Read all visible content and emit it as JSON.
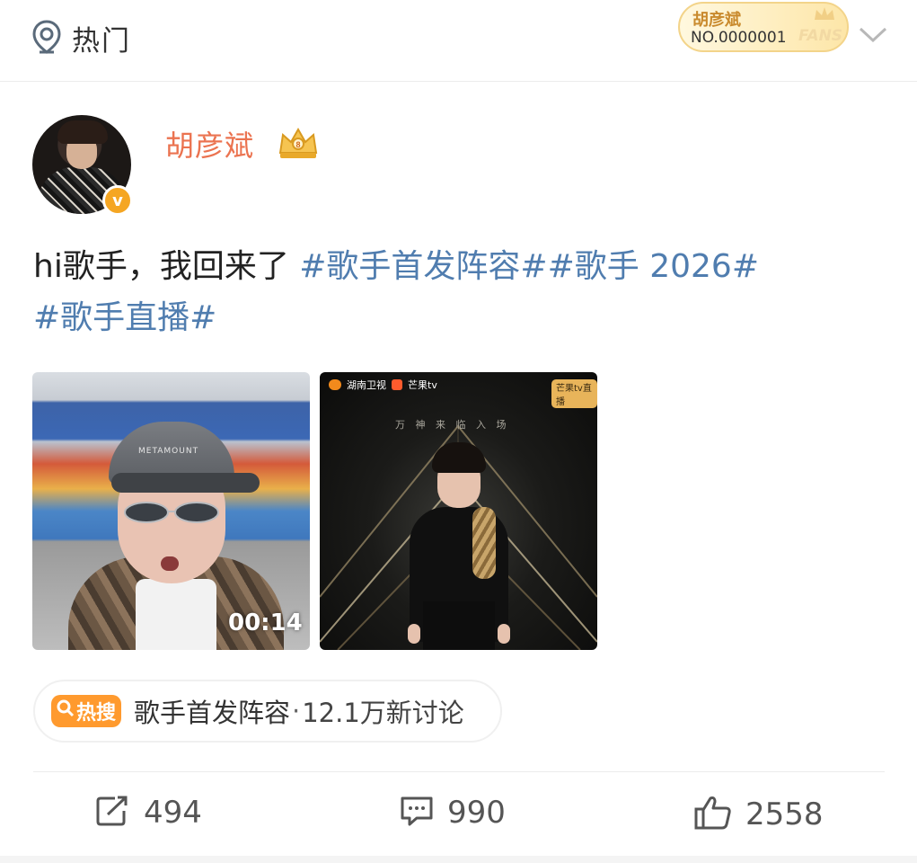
{
  "header": {
    "feed_label": "热门",
    "fans_badge": {
      "name": "胡彦斌",
      "number": "NO.0000001",
      "fans_word": "FANS"
    }
  },
  "post": {
    "author": "胡彦斌",
    "text": {
      "plain": "hi歌手，我回来了 ",
      "topic1": "#歌手首发阵容#",
      "topic2": "#歌手 2026#",
      "topic3": "#歌手直播#"
    },
    "media": {
      "video_duration": "00:14",
      "video_cap_text": "METAMOUNT",
      "poster_logo1": "湖南卫视",
      "poster_logo2": "芒果tv",
      "poster_tag": "芒果tv直播",
      "poster_tagline": "万 神 来 临    入 场"
    },
    "hot_search": {
      "badge": "热搜",
      "topic": "歌手首发阵容",
      "separator": "·",
      "count": "12.1万新讨论"
    },
    "actions": {
      "reposts": "494",
      "comments": "990",
      "likes": "2558"
    }
  },
  "colors": {
    "username": "#eb7350",
    "topic_link": "#507daf",
    "hot_badge": "#ff9a2e",
    "verified_badge": "#f5a623"
  },
  "icons": [
    "location-hot-icon",
    "chevron-down-icon",
    "crown-icon",
    "verified-icon",
    "repost-icon",
    "comment-icon",
    "like-icon",
    "search-icon"
  ]
}
